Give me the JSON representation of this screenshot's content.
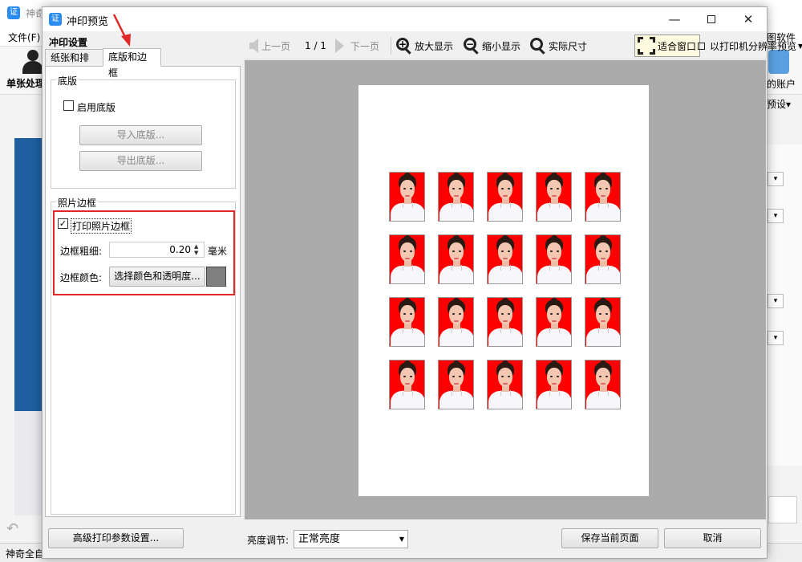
{
  "background_app": {
    "title": "神奇",
    "menu_file": "文件(F)",
    "menu_right": "图软件",
    "single_process": "单张处理",
    "account": "的账户",
    "preset": "预设▾",
    "status": "神奇全自"
  },
  "dialog": {
    "title": "冲印预览",
    "settings_heading": "冲印设置",
    "tabs": [
      "纸张和排版",
      "底版和边框"
    ],
    "base_group": {
      "title": "底版",
      "enable_label": "启用底版",
      "enable_checked": false,
      "import_label": "导入底版...",
      "export_label": "导出底版..."
    },
    "border_group": {
      "title": "照片边框",
      "print_border_label": "打印照片边框",
      "print_border_checked": true,
      "thickness_label": "边框粗细:",
      "thickness_value": "0.20",
      "thickness_unit": "毫米",
      "color_label": "边框颜色:",
      "color_button": "选择颜色和透明度...",
      "color_value": "#808080"
    },
    "toolbar": {
      "prev": "上一页",
      "page": "1 / 1",
      "next": "下一页",
      "zoom_in": "放大显示",
      "zoom_out": "缩小显示",
      "actual_size": "实际尺寸",
      "fit_window": "适合窗口",
      "printer_preview": "以打印机分辨率预览"
    },
    "bottom": {
      "advanced": "高级打印参数设置...",
      "brightness_label": "亮度调节:",
      "brightness_value": "正常亮度",
      "save": "保存当前页面",
      "cancel": "取消"
    },
    "preview": {
      "rows": 4,
      "cols": 5,
      "photo_bg": "#ff0000"
    }
  },
  "colors": {
    "highlight": "#e02828",
    "accent": "#2a8cf0"
  }
}
